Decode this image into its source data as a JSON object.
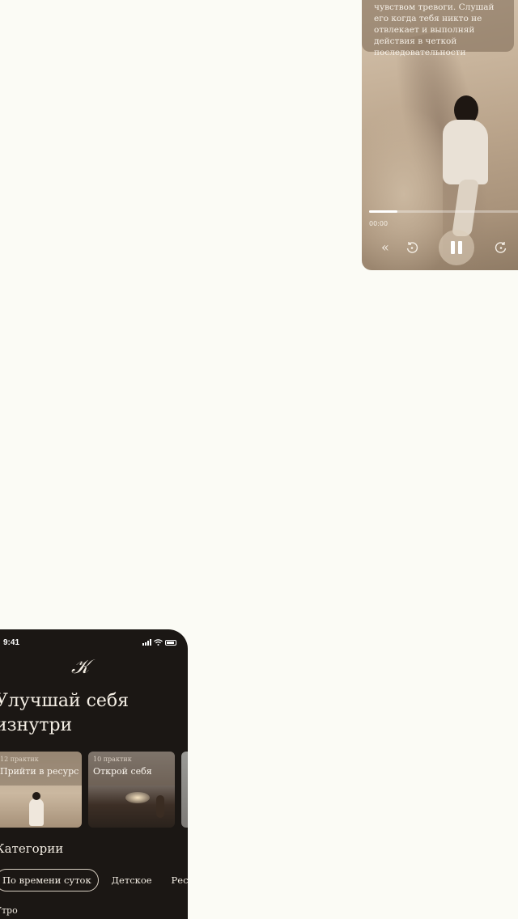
{
  "player": {
    "description": "чувством тревоги. Слушай его когда тебя никто не отвлекает и выполняй действия в четкой последовательности",
    "progress": 0.16,
    "current_time": "00:00",
    "controls": {
      "rewind": "«",
      "back": "↺",
      "fwd": "↻"
    }
  },
  "phone": {
    "status": {
      "time": "9:41"
    },
    "logo": "𝒦",
    "headline": "Улучшай себя изнутри",
    "cards": [
      {
        "meta": "12 практик",
        "title": "Прийти в ресурс"
      },
      {
        "meta": "10 практик",
        "title": "Открой себя"
      }
    ],
    "categories_title": "Категории",
    "chips": [
      "По времени суток",
      "Детское",
      "Ресурс"
    ],
    "subhead": "Утро"
  }
}
